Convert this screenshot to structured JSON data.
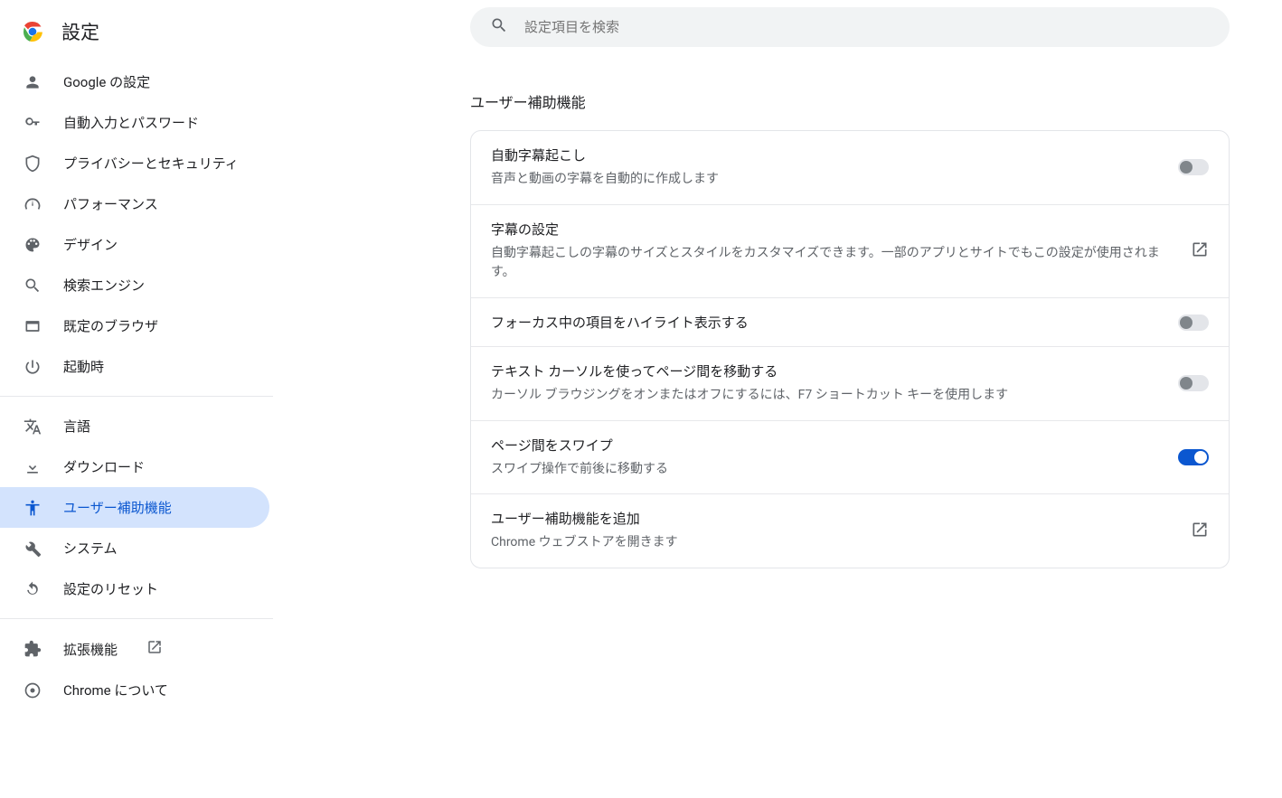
{
  "header": {
    "title": "設定"
  },
  "search": {
    "placeholder": "設定項目を検索"
  },
  "sidebar": {
    "groups": [
      {
        "items": [
          {
            "key": "google",
            "icon": "person",
            "label": "Google の設定"
          },
          {
            "key": "autofill",
            "icon": "key",
            "label": "自動入力とパスワード"
          },
          {
            "key": "privacy",
            "icon": "shield",
            "label": "プライバシーとセキュリティ"
          },
          {
            "key": "perf",
            "icon": "speed",
            "label": "パフォーマンス"
          },
          {
            "key": "design",
            "icon": "palette",
            "label": "デザイン"
          },
          {
            "key": "search",
            "icon": "search",
            "label": "検索エンジン"
          },
          {
            "key": "default",
            "icon": "window",
            "label": "既定のブラウザ"
          },
          {
            "key": "startup",
            "icon": "power",
            "label": "起動時"
          }
        ]
      },
      {
        "items": [
          {
            "key": "lang",
            "icon": "translate",
            "label": "言語"
          },
          {
            "key": "download",
            "icon": "download",
            "label": "ダウンロード"
          },
          {
            "key": "a11y",
            "icon": "accessibility",
            "label": "ユーザー補助機能",
            "active": true
          },
          {
            "key": "system",
            "icon": "wrench",
            "label": "システム"
          },
          {
            "key": "reset",
            "icon": "reset",
            "label": "設定のリセット"
          }
        ]
      },
      {
        "items": [
          {
            "key": "ext",
            "icon": "extension",
            "label": "拡張機能",
            "external": true
          },
          {
            "key": "about",
            "icon": "chrome",
            "label": "Chrome について"
          }
        ]
      }
    ]
  },
  "main": {
    "section_title": "ユーザー補助機能",
    "rows": [
      {
        "key": "live-caption",
        "title": "自動字幕起こし",
        "sub": "音声と動画の字幕を自動的に作成します",
        "control": "toggle",
        "value": false
      },
      {
        "key": "caption-settings",
        "title": "字幕の設定",
        "sub": "自動字幕起こしの字幕のサイズとスタイルをカスタマイズできます。一部のアプリとサイトでもこの設定が使用されます。",
        "control": "open"
      },
      {
        "key": "focus-highlight",
        "title": "フォーカス中の項目をハイライト表示する",
        "control": "toggle",
        "value": false
      },
      {
        "key": "caret-browsing",
        "title": "テキスト カーソルを使ってページ間を移動する",
        "sub": "カーソル ブラウジングをオンまたはオフにするには、F7 ショートカット キーを使用します",
        "control": "toggle",
        "value": false
      },
      {
        "key": "swipe-pages",
        "title": "ページ間をスワイプ",
        "sub": "スワイプ操作で前後に移動する",
        "control": "toggle",
        "value": true
      },
      {
        "key": "add-a11y",
        "title": "ユーザー補助機能を追加",
        "sub": "Chrome ウェブストアを開きます",
        "control": "open"
      }
    ]
  }
}
